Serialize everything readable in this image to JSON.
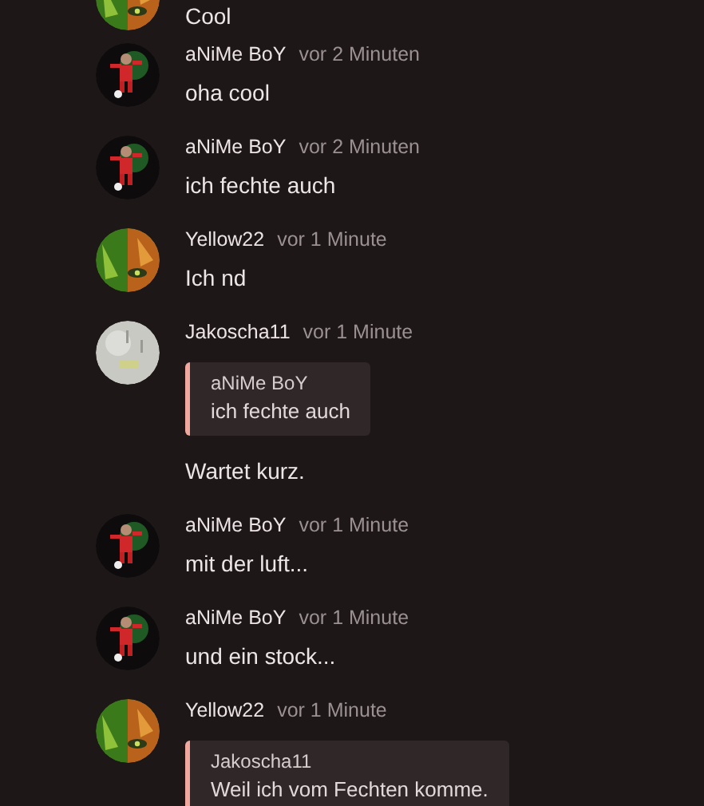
{
  "messages": [
    {
      "avatar": {
        "kind": "forest"
      },
      "text": "Cool"
    },
    {
      "avatar": {
        "kind": "figure"
      },
      "author": "aNiMe BoY",
      "time": "vor 2 Minuten",
      "text": "oha cool"
    },
    {
      "avatar": {
        "kind": "figure"
      },
      "author": "aNiMe BoY",
      "time": "vor 2 Minuten",
      "text": "ich fechte auch"
    },
    {
      "avatar": {
        "kind": "forest"
      },
      "author": "Yellow22",
      "time": "vor 1 Minute",
      "text": "Ich nd"
    },
    {
      "avatar": {
        "kind": "pale"
      },
      "author": "Jakoscha11",
      "time": "vor 1 Minute",
      "quote": {
        "author": "aNiMe BoY",
        "text": "ich fechte auch"
      },
      "text": "Wartet kurz."
    },
    {
      "avatar": {
        "kind": "figure"
      },
      "author": "aNiMe BoY",
      "time": "vor 1 Minute",
      "text": "mit der luft..."
    },
    {
      "avatar": {
        "kind": "figure"
      },
      "author": "aNiMe BoY",
      "time": "vor 1 Minute",
      "text": "und ein stock..."
    },
    {
      "avatar": {
        "kind": "forest"
      },
      "author": "Yellow22",
      "time": "vor 1 Minute",
      "quote": {
        "author": "Jakoscha11",
        "text": "Weil ich vom Fechten komme."
      }
    }
  ]
}
